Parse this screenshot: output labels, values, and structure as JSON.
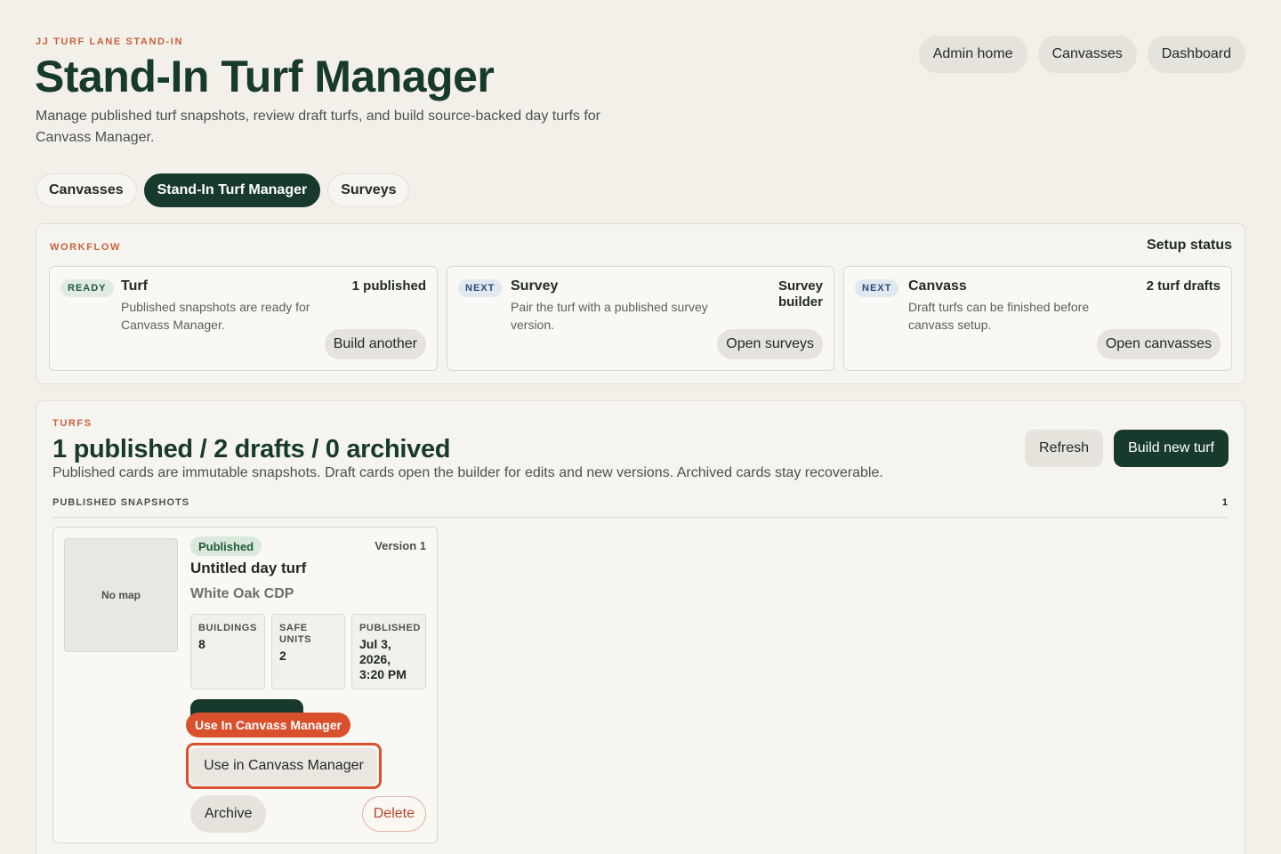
{
  "header": {
    "eyebrow": "JJ TURF LANE STAND-IN",
    "title": "Stand-In Turf Manager",
    "subtitle": "Manage published turf snapshots, review draft turfs, and build source-backed day turfs for Canvass Manager."
  },
  "top_nav": {
    "items": [
      {
        "label": "Admin home"
      },
      {
        "label": "Canvasses"
      },
      {
        "label": "Dashboard"
      }
    ]
  },
  "tabs": [
    {
      "label": "Canvasses",
      "active": false
    },
    {
      "label": "Stand-In Turf Manager",
      "active": true
    },
    {
      "label": "Surveys",
      "active": false
    }
  ],
  "workflow": {
    "label": "WORKFLOW",
    "status_label": "Setup status",
    "cards": [
      {
        "badge": "READY",
        "title": "Turf",
        "desc": "Published snapshots are ready for Canvass Manager.",
        "meta": "1 published",
        "button": "Build another"
      },
      {
        "badge": "NEXT",
        "title": "Survey",
        "desc": "Pair the turf with a published survey version.",
        "meta": "Survey builder",
        "button": "Open surveys"
      },
      {
        "badge": "NEXT",
        "title": "Canvass",
        "desc": "Draft turfs can be finished before canvass setup.",
        "meta": "2 turf drafts",
        "button": "Open canvasses"
      }
    ]
  },
  "turfs": {
    "label": "TURFS",
    "heading": "1 published / 2 drafts / 0 archived",
    "desc": "Published cards are immutable snapshots. Draft cards open the builder for edits and new versions. Archived cards stay recoverable.",
    "refresh_label": "Refresh",
    "build_label": "Build new turf",
    "published_section": {
      "label": "PUBLISHED SNAPSHOTS",
      "count": "1"
    },
    "card": {
      "map_text": "No map",
      "status": "Published",
      "version": "Version 1",
      "name": "Untitled day turf",
      "place": "White Oak CDP",
      "stats": [
        {
          "label": "BUILDINGS",
          "value": "8"
        },
        {
          "label": "SAFE UNITS",
          "value": "2"
        },
        {
          "label": "PUBLISHED",
          "value": "Jul 3, 2026, 3:20 PM"
        }
      ],
      "callout_tag": "Use In Canvass Manager",
      "use_label": "Use in Canvass Manager",
      "archive_label": "Archive",
      "delete_label": "Delete"
    }
  },
  "colors": {
    "accent": "#d9502c",
    "primary_dark": "#173a2c",
    "eyebrow": "#c8603c",
    "background": "#f3f0ea"
  }
}
